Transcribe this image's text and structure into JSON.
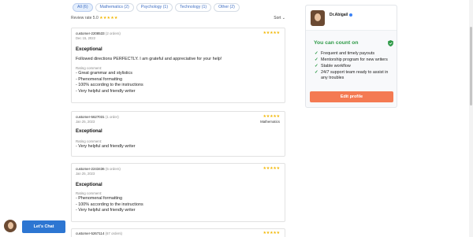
{
  "tabs": [
    {
      "label": "All (6)",
      "active": true
    },
    {
      "label": "Mathematics (2)",
      "active": false
    },
    {
      "label": "Psychology (1)",
      "active": false
    },
    {
      "label": "Technology (1)",
      "active": false
    },
    {
      "label": "Other (2)",
      "active": false
    }
  ],
  "review_rate": {
    "label": "Review rate 5.0",
    "stars": "★★★★★"
  },
  "sort_label": "Sort",
  "reviews": [
    {
      "customer": "customer-2208533",
      "orders": "(2 orders)",
      "date": "Dec 15, 2022",
      "stars": "★★★★★",
      "subject": "",
      "title": "Exceptional",
      "text": "Followed directions PERFECTLY. I am grateful and appreciative for your help!",
      "rating_comment_label": "Rating comment:",
      "lines": [
        "- Great grammar and stylistics",
        "- Phenomenal formatting",
        "- 100% according to the instructions",
        "- Very helpful and friendly writer"
      ]
    },
    {
      "customer": "customer-5627031",
      "orders": "(1 order)",
      "date": "Jan 25, 2023",
      "stars": "★★★★★",
      "subject": "Mathematics",
      "title": "Exceptional",
      "text": "",
      "rating_comment_label": "Rating comment:",
      "lines": [
        "- Very helpful and friendly writer"
      ]
    },
    {
      "customer": "customer-2243436",
      "orders": "(5 orders)",
      "date": "Jan 25, 2023",
      "stars": "★★★★★",
      "subject": "",
      "title": "Exceptional",
      "text": "",
      "rating_comment_label": "Rating comment:",
      "lines": [
        "- Phenomenal formatting",
        "- 100% according to the instructions",
        "- Very helpful and friendly writer"
      ]
    },
    {
      "customer": "customer-5267114",
      "orders": "(67 orders)",
      "date": "",
      "stars": "★★★★★",
      "subject": "",
      "title": "",
      "text": "",
      "rating_comment_label": "",
      "lines": []
    }
  ],
  "profile": {
    "name": "Dr.Abigail",
    "heading": "You can count on",
    "benefits": [
      "Frequent and timely payouts",
      "Mentorship program for new writers",
      "Stable workflow",
      "24/7 support team ready to assist in any troubles"
    ],
    "edit_button": "Edit profile"
  },
  "chat_button": "Let's Chat",
  "colors": {
    "accent_blue": "#2d76d2",
    "accent_orange": "#f47a52",
    "green": "#2e9a47",
    "star": "#f2b705"
  }
}
